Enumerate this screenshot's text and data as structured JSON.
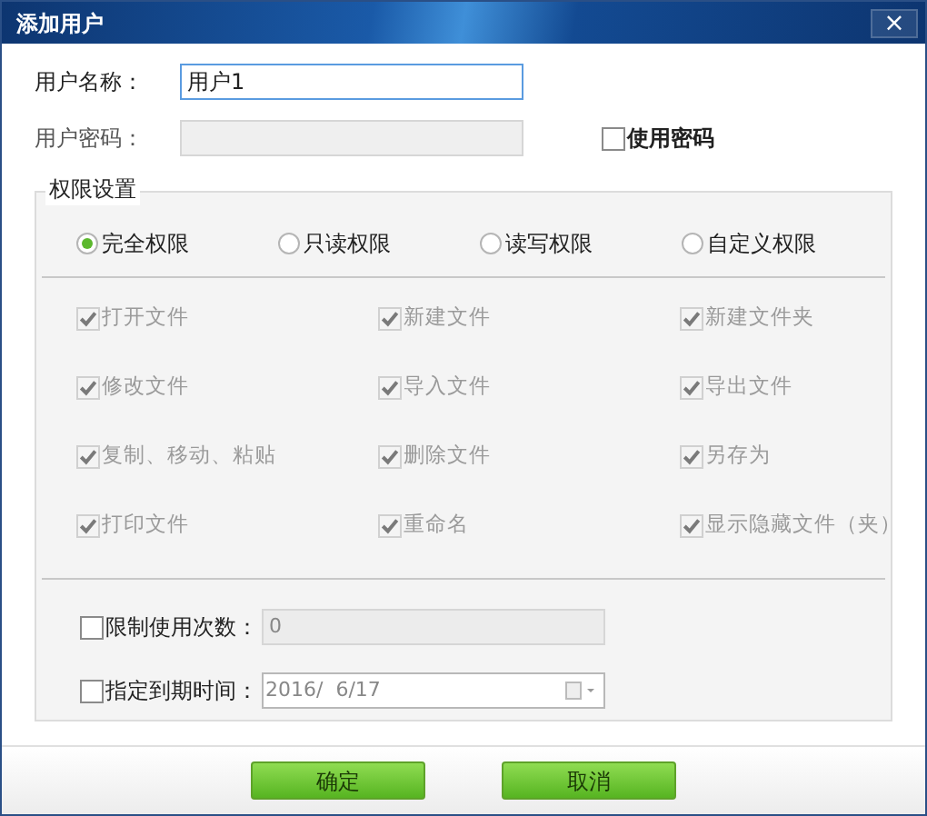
{
  "window": {
    "title": "添加用户",
    "close": "×"
  },
  "user_name": {
    "label": "用户名称：",
    "value": "用户1"
  },
  "password": {
    "label": "用户密码：",
    "disabled": true,
    "use_password": {
      "label": "使用密码",
      "checked": false
    }
  },
  "permissions": {
    "title": "权限设置",
    "modes": [
      {
        "label": "完全权限",
        "selected": true
      },
      {
        "label": "只读权限",
        "selected": false
      },
      {
        "label": "读写权限",
        "selected": false
      },
      {
        "label": "自定义权限",
        "selected": false
      }
    ],
    "items": [
      {
        "label": "打开文件",
        "checked": true,
        "disabled": true
      },
      {
        "label": "新建文件",
        "checked": true,
        "disabled": true
      },
      {
        "label": "新建文件夹",
        "checked": true,
        "disabled": true
      },
      {
        "label": "修改文件",
        "checked": true,
        "disabled": true
      },
      {
        "label": "导入文件",
        "checked": true,
        "disabled": true
      },
      {
        "label": "导出文件",
        "checked": true,
        "disabled": true
      },
      {
        "label": "复制、移动、粘贴",
        "checked": true,
        "disabled": true
      },
      {
        "label": "删除文件",
        "checked": true,
        "disabled": true
      },
      {
        "label": "另存为",
        "checked": true,
        "disabled": true
      },
      {
        "label": "打印文件",
        "checked": true,
        "disabled": true
      },
      {
        "label": "重命名",
        "checked": true,
        "disabled": true
      },
      {
        "label": "显示隐藏文件（夹）",
        "checked": true,
        "disabled": true
      }
    ]
  },
  "limit_uses": {
    "label": "限制使用次数：",
    "checked": false,
    "value": "0"
  },
  "expiry": {
    "label": "指定到期时间：",
    "checked": false,
    "value": "2016/  6/17"
  },
  "buttons": [
    "确定",
    "取消"
  ]
}
